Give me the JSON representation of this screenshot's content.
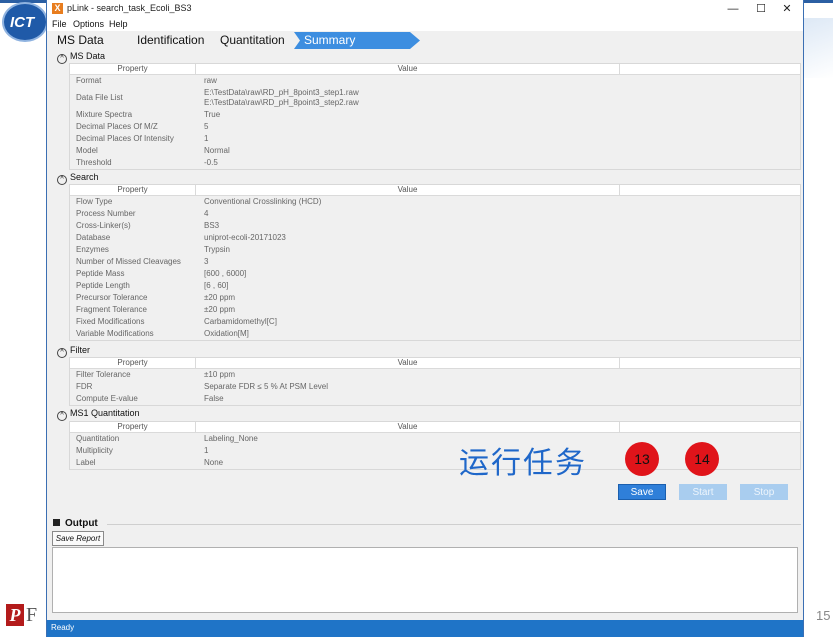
{
  "window": {
    "title": "pLink - search_task_Ecoli_BS3",
    "app_icon_letter": "X"
  },
  "window_controls": {
    "minimize": "—",
    "maximize": "☐",
    "close": "✕"
  },
  "menu": [
    "File",
    "Options",
    "Help"
  ],
  "wizard_tabs": [
    "MS Data",
    "Identification",
    "Quantitation",
    "Summary"
  ],
  "grid_headers": {
    "property": "Property",
    "value": "Value"
  },
  "sections": {
    "ms_data": {
      "title": "MS Data",
      "rows": [
        {
          "p": "Format",
          "v": "raw"
        },
        {
          "p": "Data File List",
          "v": "E:\\TestData\\raw\\RD_pH_8point3_step1.raw",
          "v2": "E:\\TestData\\raw\\RD_pH_8point3_step2.raw"
        },
        {
          "p": "Mixture Spectra",
          "v": "True"
        },
        {
          "p": "Decimal Places Of M/Z",
          "v": "5"
        },
        {
          "p": "Decimal Places Of Intensity",
          "v": "1"
        },
        {
          "p": "Model",
          "v": "Normal"
        },
        {
          "p": "Threshold",
          "v": "-0.5"
        }
      ]
    },
    "search": {
      "title": "Search",
      "rows": [
        {
          "p": "Flow Type",
          "v": "Conventional Crosslinking (HCD)"
        },
        {
          "p": "Process Number",
          "v": "4"
        },
        {
          "p": "Cross-Linker(s)",
          "v": "BS3"
        },
        {
          "p": "Database",
          "v": "uniprot-ecoli-20171023"
        },
        {
          "p": "Enzymes",
          "v": "Trypsin"
        },
        {
          "p": "Number of Missed Cleavages",
          "v": "3"
        },
        {
          "p": "Peptide Mass",
          "v": "[600 , 6000]"
        },
        {
          "p": "Peptide Length",
          "v": "[6 , 60]"
        },
        {
          "p": "Precursor Tolerance",
          "v": "±20 ppm"
        },
        {
          "p": "Fragment Tolerance",
          "v": "±20 ppm"
        },
        {
          "p": "Fixed Modifications",
          "v": "Carbamidomethyl[C]"
        },
        {
          "p": "Variable Modifications",
          "v": "Oxidation[M]"
        }
      ]
    },
    "filter": {
      "title": "Filter",
      "rows": [
        {
          "p": "Filter Tolerance",
          "v": "±10 ppm"
        },
        {
          "p": "FDR",
          "v": "Separate FDR ≤ 5 % At PSM Level"
        },
        {
          "p": "Compute E-value",
          "v": "False"
        }
      ]
    },
    "ms1_quant": {
      "title": "MS1 Quantitation",
      "rows": [
        {
          "p": "Quantitation",
          "v": "Labeling_None"
        },
        {
          "p": "Multiplicity",
          "v": "1"
        },
        {
          "p": "Label",
          "v": "None"
        }
      ]
    }
  },
  "annotation": {
    "text": "运行任务",
    "badge_save": "13",
    "badge_start": "14"
  },
  "buttons": {
    "save": "Save",
    "start": "Start",
    "stop": "Stop"
  },
  "output": {
    "title": "Output",
    "save_report": "Save Report"
  },
  "status": "Ready",
  "slide": {
    "logo_text": "ICT",
    "page_number": "15",
    "footer_letters": "P",
    "footer_letter2": "F"
  },
  "colors": {
    "accent": "#2f7fd9",
    "status_bar": "#1f74c7",
    "annotation_red": "#e0141a",
    "annotation_blue": "#1f67c9"
  }
}
